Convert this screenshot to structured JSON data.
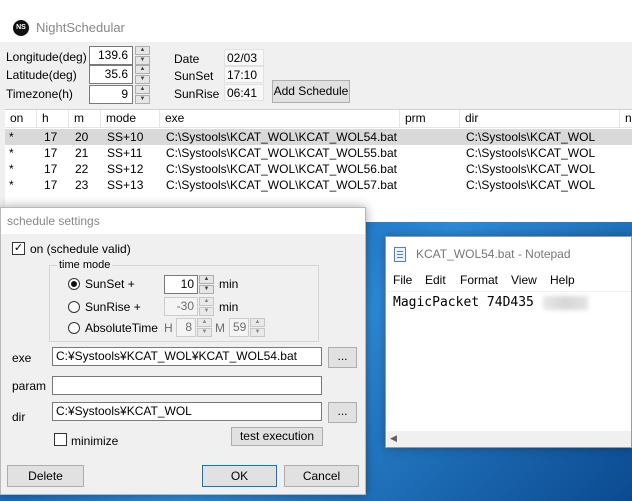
{
  "app": {
    "title": "NightSchedular",
    "logo_text": "NS"
  },
  "location": {
    "longitude_label": "Longitude(deg)",
    "longitude_value": "139.6",
    "latitude_label": "Latitude(deg)",
    "latitude_value": "35.6",
    "timezone_label": "Timezone(h)",
    "timezone_value": "9"
  },
  "info": {
    "date_label": "Date",
    "date_value": "02/03",
    "sunset_label": "SunSet",
    "sunset_value": "17:10",
    "sunrise_label": "SunRise",
    "sunrise_value": "06:41"
  },
  "add_schedule_label": "Add Schedule",
  "table": {
    "columns": [
      "on",
      "h",
      "m",
      "mode",
      "exe",
      "prm",
      "dir",
      "n"
    ],
    "rows": [
      [
        "*",
        "17",
        "20",
        "SS+10",
        "C:\\Systools\\KCAT_WOL\\KCAT_WOL54.bat",
        "",
        "C:\\Systools\\KCAT_WOL"
      ],
      [
        "*",
        "17",
        "21",
        "SS+11",
        "C:\\Systools\\KCAT_WOL\\KCAT_WOL55.bat",
        "",
        "C:\\Systools\\KCAT_WOL"
      ],
      [
        "*",
        "17",
        "22",
        "SS+12",
        "C:\\Systools\\KCAT_WOL\\KCAT_WOL56.bat",
        "",
        "C:\\Systools\\KCAT_WOL"
      ],
      [
        "*",
        "17",
        "23",
        "SS+13",
        "C:\\Systools\\KCAT_WOL\\KCAT_WOL57.bat",
        "",
        "C:\\Systools\\KCAT_WOL"
      ]
    ]
  },
  "dialog": {
    "title": "schedule settings",
    "on_label": "on (schedule valid)",
    "on_checked": true,
    "time_mode_label": "time mode",
    "sunset_label": "SunSet +",
    "sunset_value": "10",
    "sunset_unit": "min",
    "sunrise_label": "SunRise +",
    "sunrise_value": "-30",
    "sunrise_unit": "min",
    "absolute_label": "AbsoluteTime",
    "h_label": "H",
    "h_value": "8",
    "m_label": "M",
    "m_value": "59",
    "selected_mode": "SunSet",
    "exe_label": "exe",
    "exe_value": "C:¥Systools¥KCAT_WOL¥KCAT_WOL54.bat",
    "param_label": "param",
    "param_value": "",
    "dir_label": "dir",
    "dir_value": "C:¥Systools¥KCAT_WOL",
    "browse_label": "...",
    "minimize_label": "minimize",
    "minimize_checked": false,
    "test_label": "test execution",
    "delete_label": "Delete",
    "ok_label": "OK",
    "cancel_label": "Cancel"
  },
  "notepad": {
    "title": "KCAT_WOL54.bat - Notepad",
    "menu": [
      "File",
      "Edit",
      "Format",
      "View",
      "Help"
    ],
    "content": "MagicPacket 74D435"
  }
}
